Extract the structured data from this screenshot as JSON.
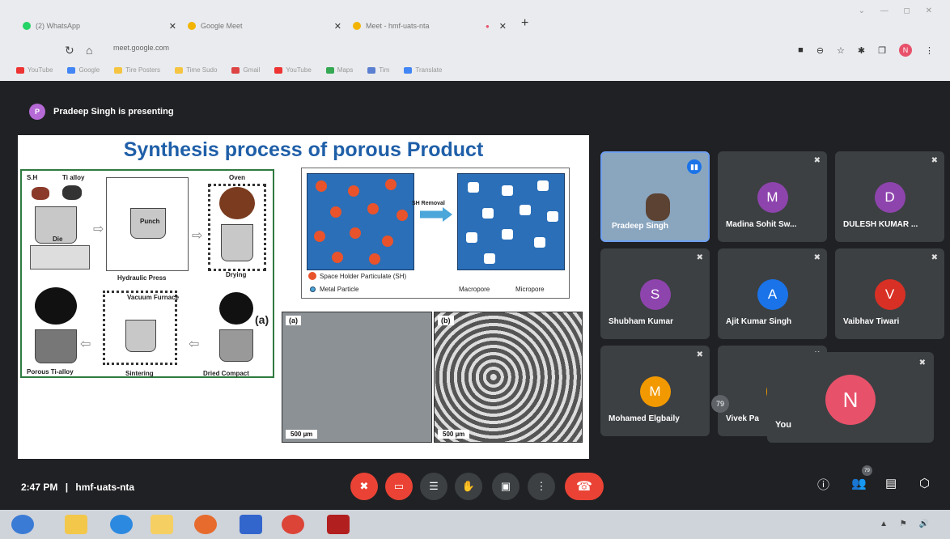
{
  "browser": {
    "tabs": [
      {
        "label": "(2) WhatsApp",
        "icon": "whatsapp-icon",
        "color": "#25d366"
      },
      {
        "label": "Google Meet",
        "icon": "meet-icon",
        "color": "#f2b400"
      },
      {
        "label": "Meet - hmf-uats-nta",
        "icon": "meet-icon",
        "color": "#f2b400"
      }
    ],
    "url": "meet.google.com",
    "bookmarks": [
      "YouTube",
      "Google",
      "Tire Posters",
      "Time Sudo",
      "Gmail",
      "YouTube",
      "Maps",
      "Tim",
      "Translate"
    ],
    "profile_initial": "N"
  },
  "meeting": {
    "presenter_banner": "Pradeep Singh is presenting",
    "presenter_initial": "P",
    "time": "2:47 PM",
    "separator": "|",
    "meeting_code": "hmf-uats-nta",
    "people_count": "79",
    "hidden_count": "79"
  },
  "slide": {
    "title": "Synthesis process of porous Product",
    "labels": {
      "sh": "S.H",
      "ti_alloy": "Ti alloy",
      "die": "Die",
      "punch": "Punch",
      "hydraulic_press": "Hydraulic Press",
      "oven": "Oven",
      "drying": "Drying",
      "vacuum_furnace": "Vacuum Furnace",
      "sintering": "Sintering",
      "dried_compact": "Dried Compact",
      "porous_ti": "Porous Ti-alloy",
      "panel_a": "(a)",
      "sh_removal": "SH Removal",
      "legend_sh": "Space Holder Particulate (SH)",
      "legend_metal": "Metal Particle",
      "macropore": "Macropore",
      "micropore": "Micropore",
      "sem_a": "(a)",
      "sem_b": "(b)",
      "scale_a": "500 µm",
      "scale_b": "500 µm"
    }
  },
  "participants": [
    {
      "name": "Pradeep Singh",
      "initial": "",
      "color": "#8aa6bf",
      "muted": false
    },
    {
      "name": "Madina Sohit Sw...",
      "initial": "M",
      "color": "#8e44ad",
      "muted": true
    },
    {
      "name": "DULESH KUMAR ...",
      "initial": "D",
      "color": "#8e44ad",
      "muted": true
    },
    {
      "name": "Shubham Kumar",
      "initial": "S",
      "color": "#8e44ad",
      "muted": true
    },
    {
      "name": "Ajit Kumar Singh",
      "initial": "A",
      "color": "#1a73e8",
      "muted": true
    },
    {
      "name": "Vaibhav Tiwari",
      "initial": "V",
      "color": "#d93025",
      "muted": true
    },
    {
      "name": "Mohamed Elgbaily",
      "initial": "M",
      "color": "#f29900",
      "muted": true
    },
    {
      "name": "Vivek Pa",
      "initial": "",
      "color": "#f29900",
      "muted": true
    },
    {
      "name": "You",
      "initial": "N",
      "color": "#e8516a",
      "muted": true
    }
  ],
  "controls": [
    "mic-off",
    "camera-off",
    "captions",
    "raise-hand",
    "present",
    "more",
    "end-call"
  ]
}
